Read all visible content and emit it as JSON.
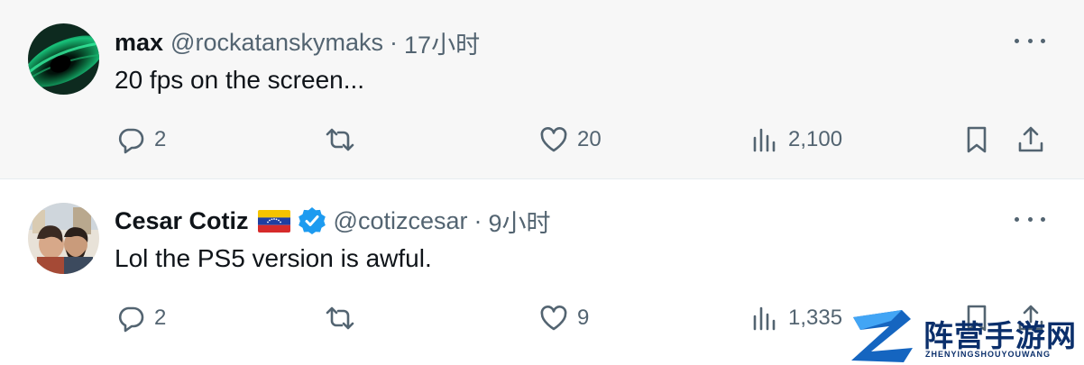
{
  "tweets": [
    {
      "name": "max",
      "handle": "@rockatanskymaks",
      "separator": "·",
      "time": "17小时",
      "text": "20 fps on the screen...",
      "replies": "2",
      "retweets": "",
      "likes": "20",
      "views": "2,100"
    },
    {
      "name": "Cesar Cotiz",
      "handle": "@cotizcesar",
      "separator": "·",
      "time": "9小时",
      "text": "Lol the PS5 version is awful.",
      "replies": "2",
      "retweets": "",
      "likes": "9",
      "views": "1,335"
    }
  ],
  "watermark": {
    "brand": "阵营手游网",
    "domain": "ZHENYINGSHOUYOUWANG"
  },
  "colors": {
    "text": "#0f1419",
    "muted": "#536471",
    "verified": "#1d9bf0",
    "watermark": "#0b2f6b"
  },
  "icons": {
    "reply": "reply-icon",
    "retweet": "retweet-icon",
    "like": "heart-icon",
    "views": "views-icon",
    "bookmark": "bookmark-icon",
    "share": "share-icon",
    "more": "more-icon",
    "verified": "verified-badge-icon",
    "flag": "venezuela-flag-icon"
  }
}
